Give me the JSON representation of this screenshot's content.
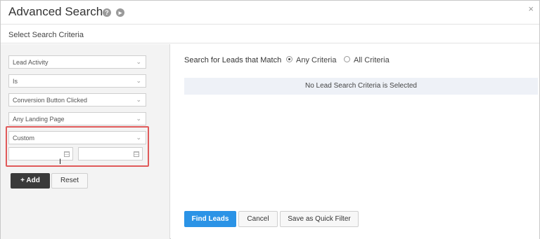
{
  "header": {
    "title": "Advanced Search",
    "help_icon": "help-icon",
    "play_icon": "play-icon",
    "close_glyph": "×"
  },
  "subheader": {
    "label": "Select Search Criteria"
  },
  "criteria": {
    "field_1": {
      "value": "Lead Activity"
    },
    "field_2": {
      "value": "Is"
    },
    "field_3": {
      "value": "Conversion Button Clicked"
    },
    "field_4": {
      "value": "Any Landing Page"
    },
    "field_5": {
      "value": "Custom"
    },
    "date_from": {
      "value": ""
    },
    "date_to": {
      "value": ""
    },
    "highlight_color": "#e05a5a"
  },
  "left_buttons": {
    "add": "+ Add",
    "reset": "Reset"
  },
  "match": {
    "label": "Search for Leads that Match",
    "option_any": "Any Criteria",
    "option_all": "All Criteria",
    "selected": "Any Criteria"
  },
  "banner": {
    "text": "No Lead Search Criteria is Selected"
  },
  "footer": {
    "find": "Find Leads",
    "cancel": "Cancel",
    "save_quick": "Save as Quick Filter",
    "primary_color": "#2b93e6"
  }
}
